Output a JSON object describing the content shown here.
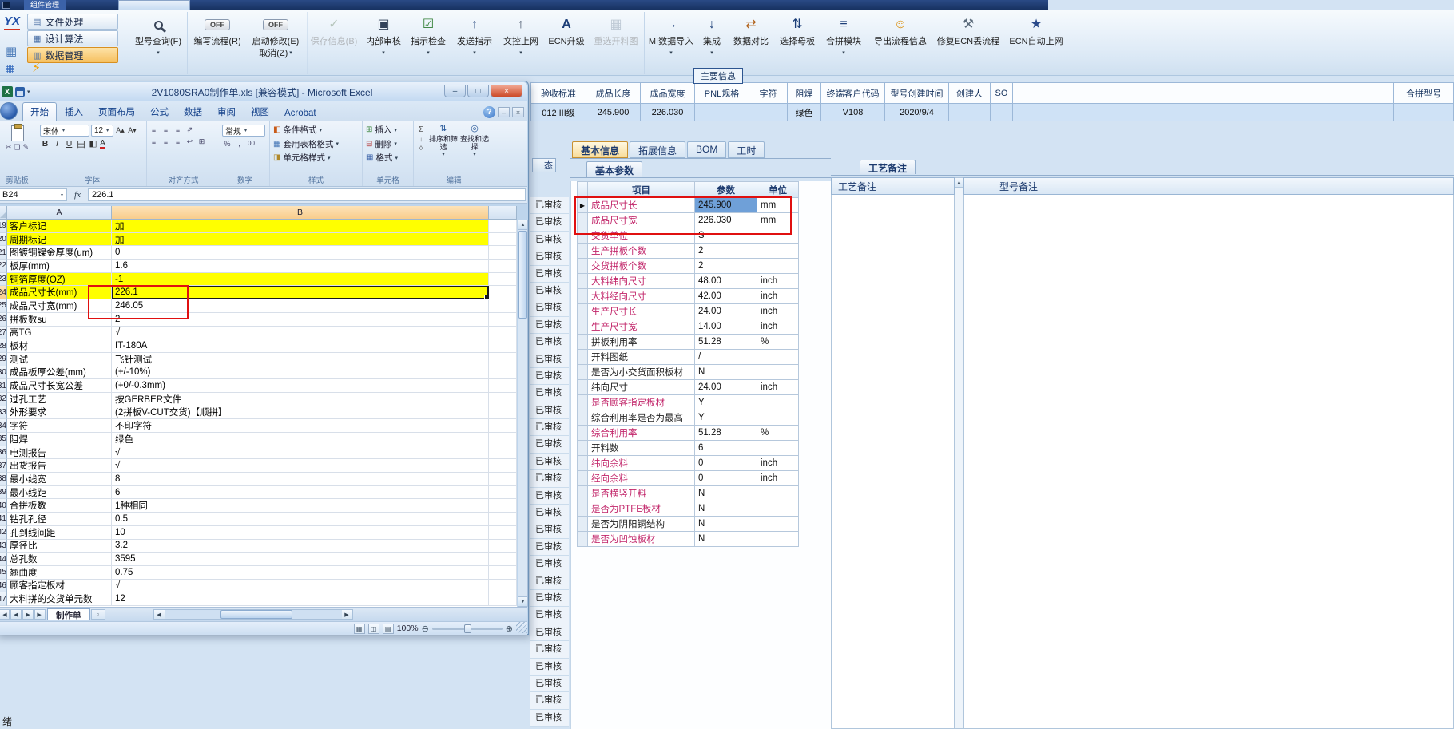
{
  "colors": {
    "annotation_red": "#e01010",
    "highlight_yellow": "#ffff00",
    "param_pink": "#c2266a",
    "selection_blue": "#6fa0d8"
  },
  "erp": {
    "window_tab": "组件管理",
    "sidebar": {
      "logo": "YX",
      "items": [
        {
          "label": "文件处理",
          "icon": "file-icon"
        },
        {
          "label": "设计算法",
          "icon": "calc-icon"
        },
        {
          "label": "数据管理",
          "icon": "data-icon",
          "active": true
        }
      ]
    },
    "ribbon": [
      {
        "label": "型号查询(F)",
        "icon": "search-icon",
        "dropdown": true
      },
      {
        "label": "编写流程(R)",
        "toggle": "OFF"
      },
      {
        "label": "启动修改(E)",
        "toggle": "OFF",
        "secondary": "取消(Z)",
        "secondary_dropdown": true
      },
      {
        "label": "保存信息(B)",
        "icon": "check-icon",
        "disabled": true
      },
      {
        "label": "内部审核",
        "icon": "audit-icon",
        "dropdown": true
      },
      {
        "label": "指示检查",
        "icon": "inspect-icon",
        "dropdown": true
      },
      {
        "label": "发送指示",
        "icon": "send-icon",
        "dropdown": true
      },
      {
        "label": "文控上网",
        "icon": "upload-icon",
        "dropdown": true
      },
      {
        "label": "ECN升级",
        "icon": "ecn-icon"
      },
      {
        "label": "重选开料图",
        "icon": "image-icon",
        "disabled": true
      },
      {
        "label": "MI数据导入",
        "icon": "import-icon",
        "dropdown": true
      },
      {
        "label": "集成",
        "icon": "integrate-icon",
        "dropdown": true
      },
      {
        "label": "数据对比",
        "icon": "compare-icon"
      },
      {
        "label": "选择母板",
        "icon": "select-icon"
      },
      {
        "label": "合拼模块",
        "icon": "module-icon",
        "dropdown": true
      },
      {
        "label": "导出流程信息",
        "icon": "smiley-icon"
      },
      {
        "label": "修复ECN丢流程",
        "icon": "repair-icon"
      },
      {
        "label": "ECN自动上网",
        "icon": "star-icon"
      }
    ],
    "status_left": "绪"
  },
  "main_info": {
    "badge": "主要信息",
    "columns": [
      "验收标准",
      "成品长度",
      "成品宽度",
      "PNL规格",
      "字符",
      "阻焊",
      "终端客户代码",
      "型号创建时间",
      "创建人",
      "SO"
    ],
    "values": [
      "012 III级",
      "245.900",
      "226.030",
      "",
      "",
      "绿色",
      "V108",
      "2020/9/4",
      "",
      ""
    ],
    "merge_column": "合拼型号",
    "merge_value": ""
  },
  "status_strip": {
    "header": "态",
    "item_label": "已审核",
    "count": 31
  },
  "detail_panel": {
    "tabs": [
      "基本信息",
      "拓展信息",
      "BOM",
      "工时"
    ],
    "active_tab": "基本信息",
    "group_tab": "基本参数",
    "table": {
      "headers": [
        "项目",
        "参数",
        "单位"
      ],
      "rows": [
        {
          "name": "成品尺寸长",
          "value": "245.900",
          "unit": "mm",
          "pink": true,
          "selected": true
        },
        {
          "name": "成品尺寸宽",
          "value": "226.030",
          "unit": "mm",
          "pink": true
        },
        {
          "name": "交货单位",
          "value": "S",
          "unit": "",
          "pink": true
        },
        {
          "name": "生产拼板个数",
          "value": "2",
          "unit": "",
          "pink": true
        },
        {
          "name": "交货拼板个数",
          "value": "2",
          "unit": "",
          "pink": true
        },
        {
          "name": "大料纬向尺寸",
          "value": "48.00",
          "unit": "inch",
          "pink": true
        },
        {
          "name": "大料经向尺寸",
          "value": "42.00",
          "unit": "inch",
          "pink": true
        },
        {
          "name": "生产尺寸长",
          "value": "24.00",
          "unit": "inch",
          "pink": true
        },
        {
          "name": "生产尺寸宽",
          "value": "14.00",
          "unit": "inch",
          "pink": true
        },
        {
          "name": "拼板利用率",
          "value": "51.28",
          "unit": "%",
          "pink": false
        },
        {
          "name": "开料图纸",
          "value": "/",
          "unit": "",
          "pink": false
        },
        {
          "name": "是否为小交货面积板材",
          "value": "N",
          "unit": "",
          "pink": false
        },
        {
          "name": "纬向尺寸",
          "value": "24.00",
          "unit": "inch",
          "pink": false
        },
        {
          "name": "是否顾客指定板材",
          "value": "Y",
          "unit": "",
          "pink": true
        },
        {
          "name": "综合利用率是否为最高",
          "value": "Y",
          "unit": "",
          "pink": false
        },
        {
          "name": "综合利用率",
          "value": "51.28",
          "unit": "%",
          "pink": true
        },
        {
          "name": "开料数",
          "value": "6",
          "unit": "",
          "pink": false
        },
        {
          "name": "纬向余料",
          "value": "0",
          "unit": "inch",
          "pink": true
        },
        {
          "name": "经向余料",
          "value": "0",
          "unit": "inch",
          "pink": true
        },
        {
          "name": "是否横竖开料",
          "value": "N",
          "unit": "",
          "pink": true
        },
        {
          "name": "是否为PTFE板材",
          "value": "N",
          "unit": "",
          "pink": true
        },
        {
          "name": "是否为阴阳铜结构",
          "value": "N",
          "unit": "",
          "pink": false
        },
        {
          "name": "是否为凹蚀板材",
          "value": "N",
          "unit": "",
          "pink": true
        }
      ]
    }
  },
  "notes_panel": {
    "tab": "工艺备注",
    "left_header": "工艺备注",
    "right_header": "型号备注"
  },
  "excel": {
    "title": "2V1080SRA0制作单.xls [兼容模式] - Microsoft Excel",
    "tabs": [
      "开始",
      "插入",
      "页面布局",
      "公式",
      "数据",
      "审阅",
      "视图",
      "Acrobat"
    ],
    "active_tab": "开始",
    "font_name": "宋体",
    "font_size": "12",
    "number_format": "常规",
    "groups": [
      "剪贴板",
      "字体",
      "对齐方式",
      "数字",
      "样式",
      "单元格",
      "编辑"
    ],
    "style_buttons": [
      "条件格式",
      "套用表格格式",
      "单元格样式"
    ],
    "cell_buttons": [
      "插入",
      "删除",
      "格式"
    ],
    "edit_buttons": [
      "排序和筛选",
      "查找和选择"
    ],
    "name_box": "B24",
    "fx": "fx",
    "formula_value": "226.1",
    "col_headers": [
      "A",
      "B"
    ],
    "selected": {
      "row": 24,
      "col": "B"
    },
    "rows": [
      {
        "n": 19,
        "a": "客户标记",
        "b": "加",
        "y": true
      },
      {
        "n": 20,
        "a": "周期标记",
        "b": "加",
        "y": true
      },
      {
        "n": 21,
        "a": "图镀铜镍金厚度(um)",
        "b": "0"
      },
      {
        "n": 22,
        "a": "板厚(mm)",
        "b": "1.6"
      },
      {
        "n": 23,
        "a": "铜箔厚度(OZ)",
        "b": "-1",
        "y": true
      },
      {
        "n": 24,
        "a": "成品尺寸长(mm)",
        "b": "226.1",
        "y": true
      },
      {
        "n": 25,
        "a": "成品尺寸宽(mm)",
        "b": "246.05"
      },
      {
        "n": 26,
        "a": "拼板数su",
        "b": "2"
      },
      {
        "n": 27,
        "a": "高TG",
        "b": "√"
      },
      {
        "n": 28,
        "a": "板材",
        "b": "IT-180A"
      },
      {
        "n": 29,
        "a": "测试",
        "b": "飞针测试"
      },
      {
        "n": 30,
        "a": "成品板厚公差(mm)",
        "b": "(+/-10%)"
      },
      {
        "n": 31,
        "a": "成品尺寸长宽公差",
        "b": "(+0/-0.3mm)"
      },
      {
        "n": 32,
        "a": "过孔工艺",
        "b": "按GERBER文件"
      },
      {
        "n": 33,
        "a": "外形要求",
        "b": "(2拼板V-CUT交货)【顺拼】"
      },
      {
        "n": 34,
        "a": "字符",
        "b": "不印字符"
      },
      {
        "n": 35,
        "a": "阻焊",
        "b": "绿色"
      },
      {
        "n": 36,
        "a": "电测报告",
        "b": "√"
      },
      {
        "n": 37,
        "a": "出货报告",
        "b": "√"
      },
      {
        "n": 38,
        "a": "最小线宽",
        "b": "8"
      },
      {
        "n": 39,
        "a": "最小线距",
        "b": "6"
      },
      {
        "n": 40,
        "a": "合拼板数",
        "b": "1种相同"
      },
      {
        "n": 41,
        "a": "钻孔孔径",
        "b": "0.5"
      },
      {
        "n": 42,
        "a": "孔到线间距",
        "b": "10"
      },
      {
        "n": 43,
        "a": "厚径比",
        "b": "3.2"
      },
      {
        "n": 44,
        "a": "总孔数",
        "b": "3595"
      },
      {
        "n": 45,
        "a": "翘曲度",
        "b": "0.75"
      },
      {
        "n": 46,
        "a": "顾客指定板材",
        "b": "√"
      },
      {
        "n": 47,
        "a": "大料拼的交货单元数",
        "b": "12"
      }
    ],
    "sheet_tab": "制作单",
    "zoom": "100%"
  }
}
